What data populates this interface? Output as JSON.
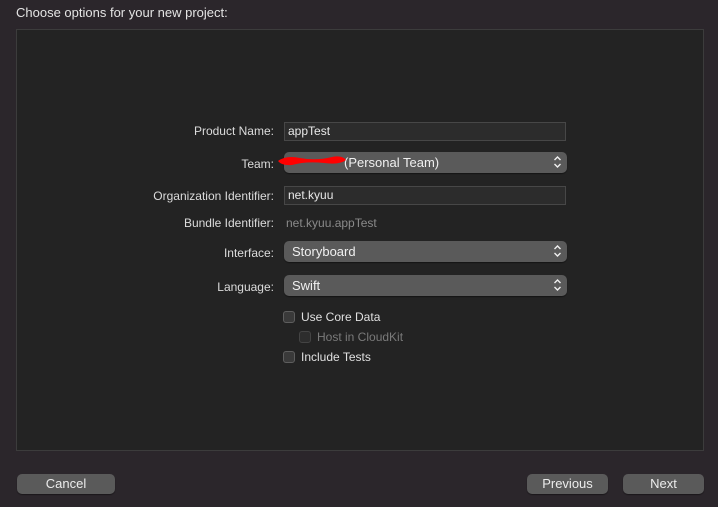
{
  "header": {
    "title": "Choose options for your new project:"
  },
  "form": {
    "product_name": {
      "label": "Product Name:",
      "value": "appTest"
    },
    "team": {
      "label": "Team:",
      "value": "(Personal Team)"
    },
    "organization_identifier": {
      "label": "Organization Identifier:",
      "value": "net.kyuu"
    },
    "bundle_identifier": {
      "label": "Bundle Identifier:",
      "value": "net.kyuu.appTest"
    },
    "interface": {
      "label": "Interface:",
      "value": "Storyboard"
    },
    "language": {
      "label": "Language:",
      "value": "Swift"
    },
    "use_core_data": {
      "label": "Use Core Data",
      "checked": false
    },
    "host_in_cloudkit": {
      "label": "Host in CloudKit",
      "checked": false,
      "enabled": false
    },
    "include_tests": {
      "label": "Include Tests",
      "checked": false
    }
  },
  "footer": {
    "cancel_label": "Cancel",
    "previous_label": "Previous",
    "next_label": "Next"
  },
  "colors": {
    "background": "#2b262b",
    "panel": "#232323",
    "button": "#5a5a5a",
    "redaction": "#ff0000"
  },
  "icons": {
    "popup_indicator": "chevron-up-down-icon"
  }
}
